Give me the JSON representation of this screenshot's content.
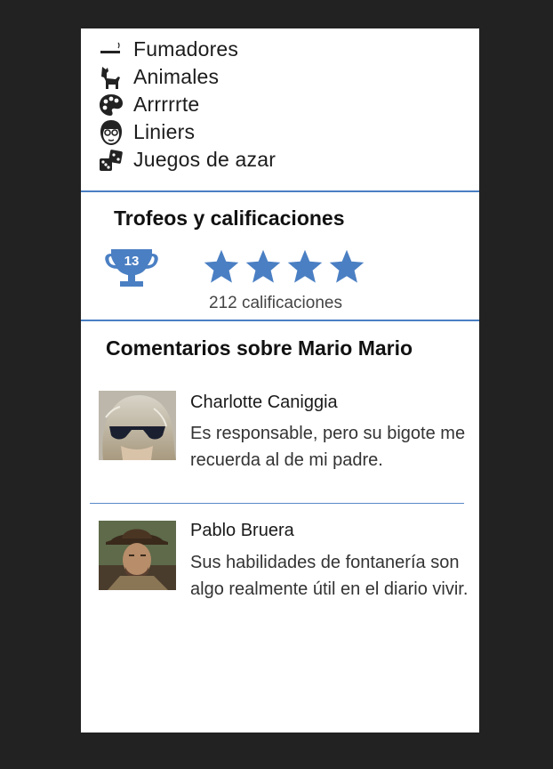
{
  "preferences": [
    {
      "label": "Fumadores",
      "icon": "cigarette-icon"
    },
    {
      "label": "Animales",
      "icon": "dog-icon"
    },
    {
      "label": "Arrrrrte",
      "icon": "palette-icon"
    },
    {
      "label": "Liniers",
      "icon": "liniers-face-icon"
    },
    {
      "label": "Juegos de azar",
      "icon": "dice-icon"
    }
  ],
  "trophies": {
    "title": "Trofeos y calificaciones",
    "trophy_count": "13",
    "stars": 4,
    "rating_count_label": "212 calificaciones"
  },
  "comments": {
    "title": "Comentarios sobre Mario Mario",
    "items": [
      {
        "name": "Charlotte Caniggia",
        "line1": "Es responsable, pero su bigote me",
        "line2": "recuerda al de mi padre."
      },
      {
        "name": "Pablo Bruera",
        "line1": "Sus habilidades de fontanería son",
        "line2": "algo realmente útil en el diario vivir."
      }
    ]
  },
  "colors": {
    "accent": "#4a7fc3",
    "background": "#222222",
    "card": "#ffffff"
  }
}
